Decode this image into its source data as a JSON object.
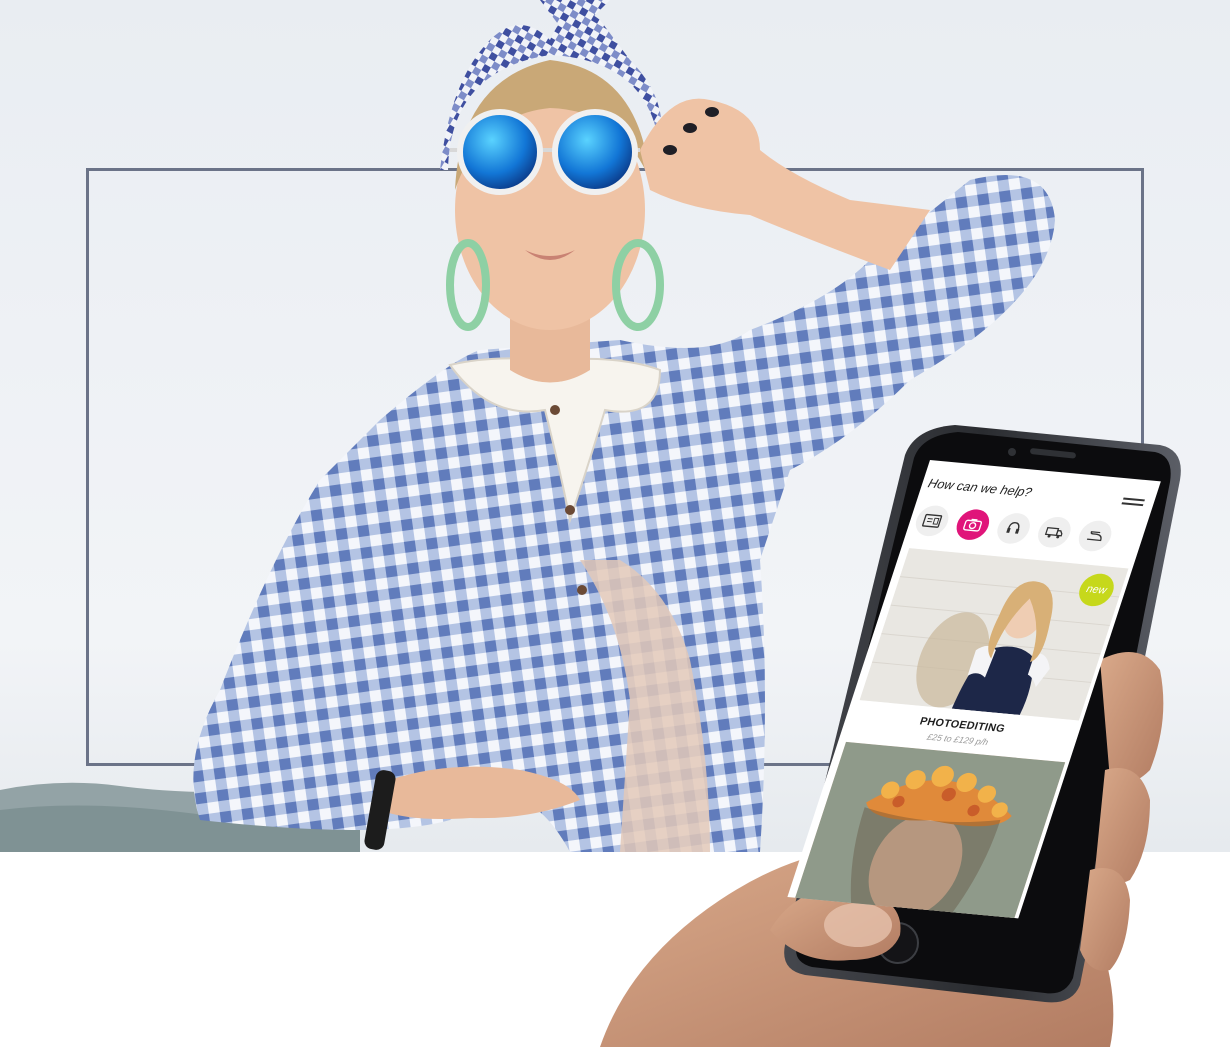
{
  "app": {
    "header_title": "How can we help?",
    "menu_icon": "hamburger-menu-icon"
  },
  "categories": [
    {
      "icon": "id-card-icon",
      "active": false
    },
    {
      "icon": "camera-icon",
      "active": true
    },
    {
      "icon": "headset-icon",
      "active": false
    },
    {
      "icon": "delivery-truck-icon",
      "active": false
    },
    {
      "icon": "iron-icon",
      "active": false
    }
  ],
  "featured": {
    "badge": "new",
    "title": "PHOTOEDITING",
    "price": "£25 to £129 p/h"
  },
  "colors": {
    "accent": "#e0157a",
    "badge": "#c6d81b",
    "frame": "#6b7388",
    "phone_body": "#2b2d31"
  }
}
